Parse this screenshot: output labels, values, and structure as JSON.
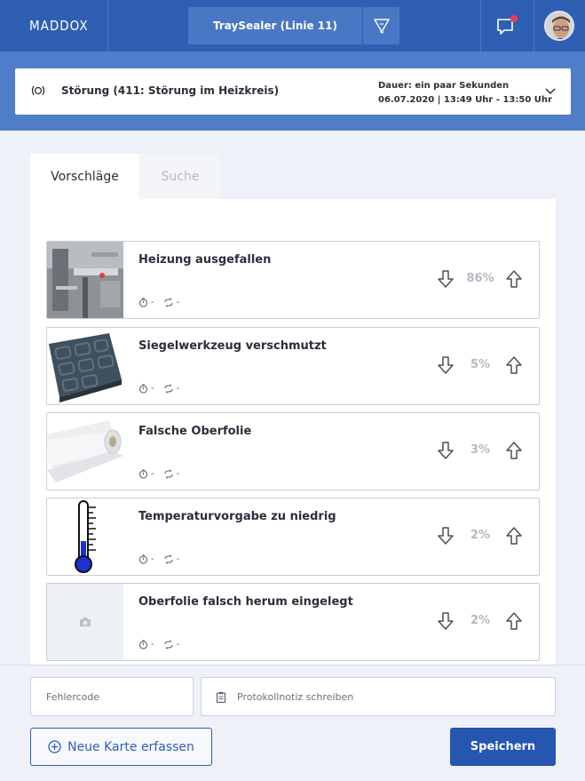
{
  "header": {
    "logo": "MADDOX",
    "machine": "TraySealer (Linie 11)",
    "filter_icon": "filter-icon",
    "chat_icon": "chat-notification-icon",
    "notification_color": "#e8414a"
  },
  "incident": {
    "title": "Störung (411: Störung im Heizkreis)",
    "duration": "Dauer: ein paar Sekunden",
    "time": "06.07.2020 | 13:49 Uhr - 13:50 Uhr"
  },
  "tabs": [
    {
      "label": "Vorschläge",
      "active": true
    },
    {
      "label": "Suche",
      "active": false
    }
  ],
  "suggestions": [
    {
      "title": "Heizung ausgefallen",
      "time": "-",
      "repeat": "-",
      "percent": "86%",
      "image": "machine-photo"
    },
    {
      "title": "Siegelwerkzeug verschmutzt",
      "time": "-",
      "repeat": "-",
      "percent": "5%",
      "image": "tray-photo"
    },
    {
      "title": "Falsche Oberfolie",
      "time": "-",
      "repeat": "-",
      "percent": "3%",
      "image": "foil-roll-photo"
    },
    {
      "title": "Temperaturvorgabe zu niedrig",
      "time": "-",
      "repeat": "-",
      "percent": "2%",
      "image": "thermometer-icon"
    },
    {
      "title": "Oberfolie falsch herum eingelegt",
      "time": "-",
      "repeat": "-",
      "percent": "2%",
      "image": "camera-placeholder-icon"
    }
  ],
  "footer": {
    "error_code_placeholder": "Fehlercode",
    "note_placeholder": "Protokollnotiz schreiben",
    "new_card": "Neue Karte erfassen",
    "save": "Speichern"
  },
  "colors": {
    "brand": "#2f5fb3",
    "primary_button": "#2556b0"
  }
}
